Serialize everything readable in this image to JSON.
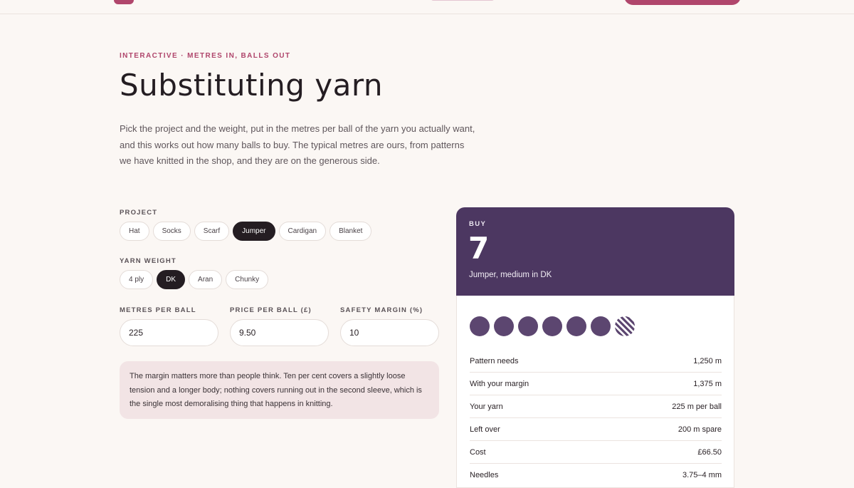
{
  "hero": {
    "eyebrow": "INTERACTIVE · METRES IN, BALLS OUT",
    "title": "Substituting yarn",
    "lede": "Pick the project and the weight, put in the metres per ball of the yarn you actually want, and this works out how many balls to buy. The typical metres are ours, from patterns we have knitted in the shop, and they are on the generous side."
  },
  "project": {
    "label": "PROJECT",
    "options": [
      "Hat",
      "Socks",
      "Scarf",
      "Jumper",
      "Cardigan",
      "Blanket"
    ],
    "selected": "Jumper"
  },
  "yarn_weight": {
    "label": "YARN WEIGHT",
    "options": [
      "4 ply",
      "DK",
      "Aran",
      "Chunky"
    ],
    "selected": "DK"
  },
  "inputs": {
    "metres_label": "METRES PER BALL",
    "metres_value": "225",
    "price_label": "PRICE PER BALL (£)",
    "price_value": "9.50",
    "margin_label": "SAFETY MARGIN (%)",
    "margin_value": "10"
  },
  "note": "The margin matters more than people think. Ten per cent covers a slightly loose tension and a longer body; nothing covers running out in the second sleeve, which is the single most demoralising thing that happens in knitting.",
  "result": {
    "buy_label": "BUY",
    "buy_count": "7",
    "description": "Jumper, medium in DK",
    "full_balls": 6,
    "partial_balls": 1,
    "rows": [
      {
        "label": "Pattern needs",
        "value": "1,250 m"
      },
      {
        "label": "With your margin",
        "value": "1,375 m"
      },
      {
        "label": "Your yarn",
        "value": "225 m per ball"
      },
      {
        "label": "Left over",
        "value": "200 m spare"
      },
      {
        "label": "Cost",
        "value": "£66.50"
      },
      {
        "label": "Needles",
        "value": "3.75–4 mm"
      }
    ]
  },
  "colors": {
    "accent": "#b0466c",
    "card_header": "#4c3761",
    "ball": "#5c4670",
    "chip_active": "#241d22"
  }
}
